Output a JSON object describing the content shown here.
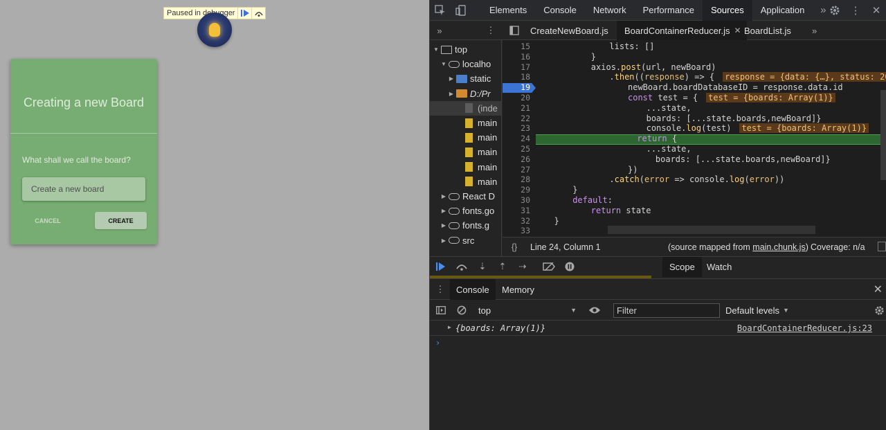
{
  "viewport": {
    "paused_label": "Paused in debugger",
    "card": {
      "title": "Creating a new Board",
      "question": "What shall we call the board?",
      "input_placeholder": "Create a new board",
      "cancel_label": "CANCEL",
      "create_label": "CREATE",
      "bg_color": "#77ad72"
    }
  },
  "devtools": {
    "main_tabs": [
      "Elements",
      "Console",
      "Network",
      "Performance",
      "Sources",
      "Application"
    ],
    "active_main_tab": "Sources",
    "file_tabs": [
      "CreateNewBoard.js",
      "BoardContainerReducer.js",
      "BoardList.js"
    ],
    "active_file_tab": "BoardContainerReducer.js",
    "navigator": [
      {
        "label": "top",
        "icon": "frame-icon"
      },
      {
        "label": "localho",
        "icon": "cloud-icon"
      },
      {
        "label": "static",
        "icon": "folder-icon"
      },
      {
        "label": "D:/Pr",
        "icon": "folder-icon"
      },
      {
        "label": "(inde",
        "icon": "file-icon"
      },
      {
        "label": "main",
        "icon": "file-icon"
      },
      {
        "label": "main",
        "icon": "file-icon"
      },
      {
        "label": "main",
        "icon": "file-icon"
      },
      {
        "label": "main",
        "icon": "file-icon"
      },
      {
        "label": "main",
        "icon": "file-icon"
      },
      {
        "label": "React D",
        "icon": "cloud-icon"
      },
      {
        "label": "fonts.go",
        "icon": "cloud-icon"
      },
      {
        "label": "fonts.g",
        "icon": "cloud-icon"
      },
      {
        "label": "src",
        "icon": "cloud-icon"
      }
    ],
    "code_lines": [
      {
        "n": "15",
        "text": "lists: []"
      },
      {
        "n": "16",
        "text": "}"
      },
      {
        "n": "17",
        "text": "axios.post(url, newBoard)"
      },
      {
        "n": "18",
        "text": ".then((response) => {",
        "inline": "response = {data: {…}, status: 20"
      },
      {
        "n": "19",
        "text": "newBoard.boardDatabaseID = response.data.id"
      },
      {
        "n": "20",
        "text": "const test = {",
        "inline": "test = {boards: Array(1)}"
      },
      {
        "n": "21",
        "text": "...state,"
      },
      {
        "n": "22",
        "text": "boards: [...state.boards,newBoard]}"
      },
      {
        "n": "23",
        "text": "console.log(test)",
        "inline": "test = {boards: Array(1)}"
      },
      {
        "n": "24",
        "text": "return {"
      },
      {
        "n": "25",
        "text": "...state,"
      },
      {
        "n": "26",
        "text": "boards: [...state.boards,newBoard]}"
      },
      {
        "n": "27",
        "text": "})"
      },
      {
        "n": "28",
        "text": ".catch(error => console.log(error))"
      },
      {
        "n": "29",
        "text": "}"
      },
      {
        "n": "30",
        "text": "default:"
      },
      {
        "n": "31",
        "text": "return state"
      },
      {
        "n": "32",
        "text": "}"
      },
      {
        "n": "33",
        "text": ""
      }
    ],
    "breakpoint_line": "19",
    "paused_line": "24",
    "status": {
      "cursor": "Line 24, Column 1",
      "source_map_prefix": "(source mapped from ",
      "source_map_file": "main.chunk.js",
      "source_map_suffix": ")",
      "coverage": "Coverage: n/a"
    },
    "sidebar_tabs": [
      "Scope",
      "Watch"
    ],
    "active_sidebar_tab": "Scope",
    "drawer_tabs": [
      "Console",
      "Memory"
    ],
    "active_drawer_tab": "Console",
    "console": {
      "context": "top",
      "filter_placeholder": "Filter",
      "levels": "Default levels",
      "log_message": "{boards: Array(1)}",
      "log_source": "BoardContainerReducer.js:23",
      "prompt": "›"
    }
  }
}
